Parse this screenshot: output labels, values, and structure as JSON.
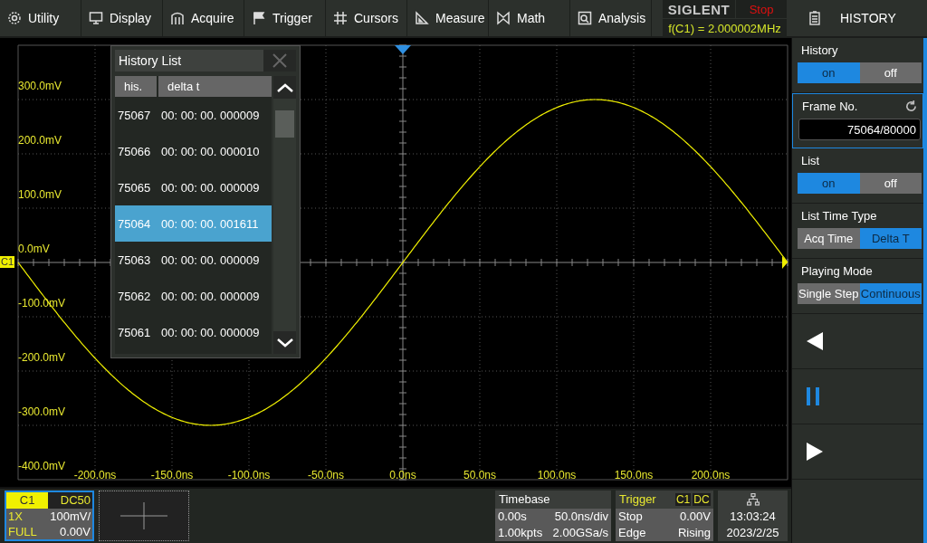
{
  "menu_bar": {
    "items": [
      {
        "label": "Utility"
      },
      {
        "label": "Display"
      },
      {
        "label": "Acquire"
      },
      {
        "label": "Trigger"
      },
      {
        "label": "Cursors"
      },
      {
        "label": "Measure"
      },
      {
        "label": "Math"
      },
      {
        "label": "Analysis"
      }
    ]
  },
  "brand": {
    "logo": "SIGLENT",
    "run_state": "Stop",
    "frequency": "f(C1) = 2.000002MHz"
  },
  "scope": {
    "channel_marker": "C1",
    "y_labels": [
      "300.0mV",
      "200.0mV",
      "100.0mV",
      "0.0mV",
      "-100.0mV",
      "-200.0mV",
      "-300.0mV",
      "-400.0mV"
    ],
    "x_labels": [
      "-200.0ns",
      "-150.0ns",
      "-100.0ns",
      "-50.0ns",
      "0.0ns",
      "50.0ns",
      "100.0ns",
      "150.0ns",
      "200.0ns"
    ]
  },
  "history_list": {
    "title": "History List",
    "columns": [
      "his.",
      "delta t"
    ],
    "rows": [
      {
        "his": "75067",
        "delta_t": "00: 00: 00. 000009",
        "selected": false
      },
      {
        "his": "75066",
        "delta_t": "00: 00: 00. 000010",
        "selected": false
      },
      {
        "his": "75065",
        "delta_t": "00: 00: 00. 000009",
        "selected": false
      },
      {
        "his": "75064",
        "delta_t": "00: 00: 00. 001611",
        "selected": true
      },
      {
        "his": "75063",
        "delta_t": "00: 00: 00. 000009",
        "selected": false
      },
      {
        "his": "75062",
        "delta_t": "00: 00: 00. 000009",
        "selected": false
      },
      {
        "his": "75061",
        "delta_t": "00: 00: 00. 000009",
        "selected": false
      }
    ]
  },
  "panel": {
    "title": "HISTORY",
    "sections": [
      {
        "kind": "toggle",
        "label": "History",
        "options": [
          {
            "label": "on",
            "selected": true
          },
          {
            "label": "off",
            "selected": false
          }
        ]
      },
      {
        "kind": "field",
        "label": "Frame No.",
        "value": "75064/80000"
      },
      {
        "kind": "toggle",
        "label": "List",
        "options": [
          {
            "label": "on",
            "selected": true
          },
          {
            "label": "off",
            "selected": false
          }
        ]
      },
      {
        "kind": "toggle",
        "label": "List Time Type",
        "options": [
          {
            "label": "Acq Time",
            "selected": false
          },
          {
            "label": "Delta T",
            "selected": true
          }
        ]
      },
      {
        "kind": "toggle",
        "label": "Playing Mode",
        "options": [
          {
            "label": "Single Step",
            "selected": false
          },
          {
            "label": "Continuous",
            "selected": true
          }
        ]
      }
    ]
  },
  "status": {
    "channel": {
      "name": "C1",
      "coupling": "DC50",
      "probe": "1X",
      "scale": "100mV/",
      "bandwidth": "FULL",
      "offset": "0.00V"
    },
    "timebase": {
      "title": "Timebase",
      "delay": "0.00s",
      "scale": "50.0ns/div",
      "memory": "1.00kpts",
      "rate": "2.00GSa/s"
    },
    "trigger": {
      "title": "Trigger",
      "source": "C1",
      "coupling": "DC",
      "state": "Stop",
      "level": "0.00V",
      "type": "Edge",
      "slope": "Rising"
    },
    "clock": {
      "time": "13:03:24",
      "date": "2023/2/25"
    }
  }
}
